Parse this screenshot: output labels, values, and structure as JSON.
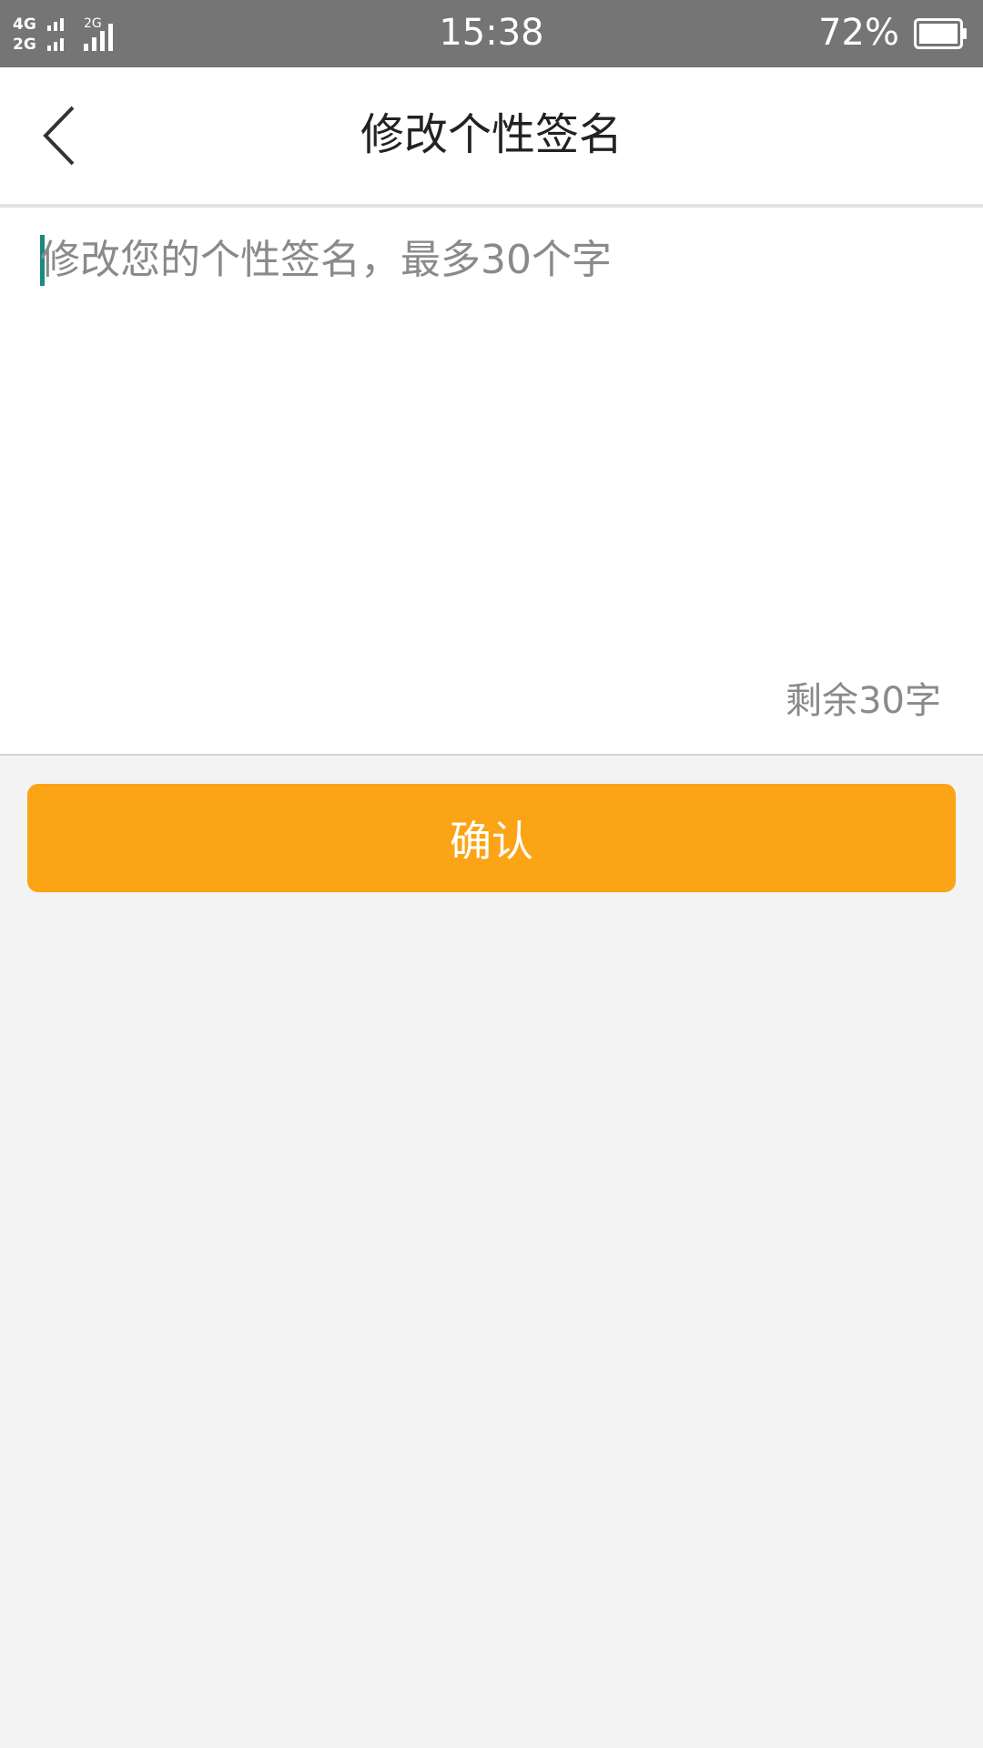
{
  "status_bar": {
    "network_1": "4G",
    "network_2": "2G",
    "network_3": "2G",
    "time": "15:38",
    "battery_percent": "72%",
    "icons": [
      "signal-icon",
      "battery-icon"
    ]
  },
  "header": {
    "title": "修改个性签名",
    "back_icon": "chevron-left-icon"
  },
  "editor": {
    "value": "",
    "placeholder": "修改您的个性签名，最多30个字",
    "counter": "剩余30字"
  },
  "confirm_button": {
    "label": "确认"
  },
  "colors": {
    "status_bar": "#757575",
    "accent": "#fba415",
    "caret": "#1a8a7f",
    "background": "#f3f3f3"
  }
}
